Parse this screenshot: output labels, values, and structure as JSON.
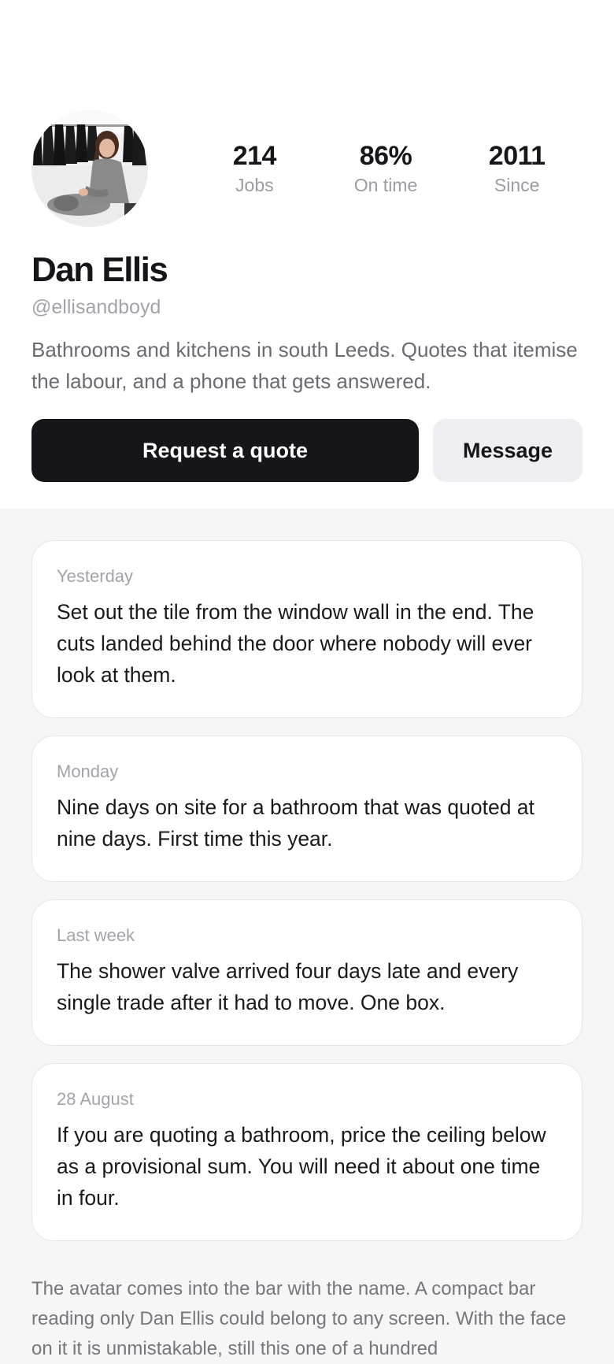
{
  "profile": {
    "name": "Dan Ellis",
    "handle": "@ellisandboyd",
    "bio": "Bathrooms and kitchens in south Leeds. Quotes that itemise the labour, and a phone that gets answered.",
    "stats": [
      {
        "value": "214",
        "label": "Jobs"
      },
      {
        "value": "86%",
        "label": "On time"
      },
      {
        "value": "2011",
        "label": "Since"
      }
    ],
    "actions": {
      "primary_label": "Request a quote",
      "secondary_label": "Message"
    }
  },
  "posts": [
    {
      "date": "Yesterday",
      "text": "Set out the tile from the window wall in the end. The cuts landed behind the door where nobody will ever look at them."
    },
    {
      "date": "Monday",
      "text": "Nine days on site for a bathroom that was quoted at nine days. First time this year."
    },
    {
      "date": "Last week",
      "text": "The shower valve arrived four days late and every single trade after it had to move. One box."
    },
    {
      "date": "28 August",
      "text": "If you are quoting a bathroom, price the ceiling below as a provisional sum. You will need it about one time in four."
    }
  ],
  "footnote": "The avatar comes into the bar with the name. A compact bar reading only Dan Ellis could belong to any screen. With the face on it it is unmistakable, still this one of a hundred"
}
